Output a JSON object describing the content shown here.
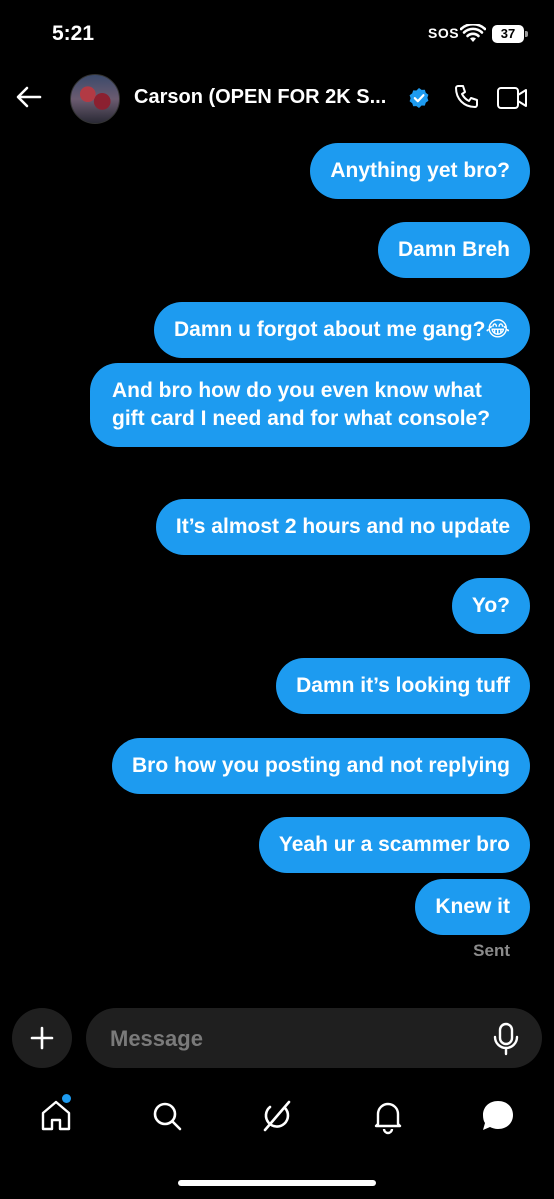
{
  "status_bar": {
    "time": "5:21",
    "sos": "SOS",
    "battery": "37"
  },
  "header": {
    "name": "Carson (OPEN FOR 2K S...",
    "verified": true
  },
  "messages": [
    "Anything yet bro?",
    "Damn Breh",
    "Damn u forgot about me gang?😂",
    "And bro how do you even know what gift card I need and for what console?",
    "It’s almost 2 hours and no update",
    "Yo?",
    "Damn it’s looking tuff",
    "Bro how you posting and not replying",
    "Yeah ur a scammer bro",
    "Knew it"
  ],
  "sent_label": "Sent",
  "composer": {
    "placeholder": "Message"
  },
  "nav": {
    "items": [
      "home-icon",
      "search-icon",
      "grok-icon",
      "notifications-icon",
      "messages-icon"
    ],
    "home_has_badge": true
  },
  "colors": {
    "accent": "#1d9bf0",
    "background": "#000000",
    "input_bg": "#1f1f1f"
  }
}
